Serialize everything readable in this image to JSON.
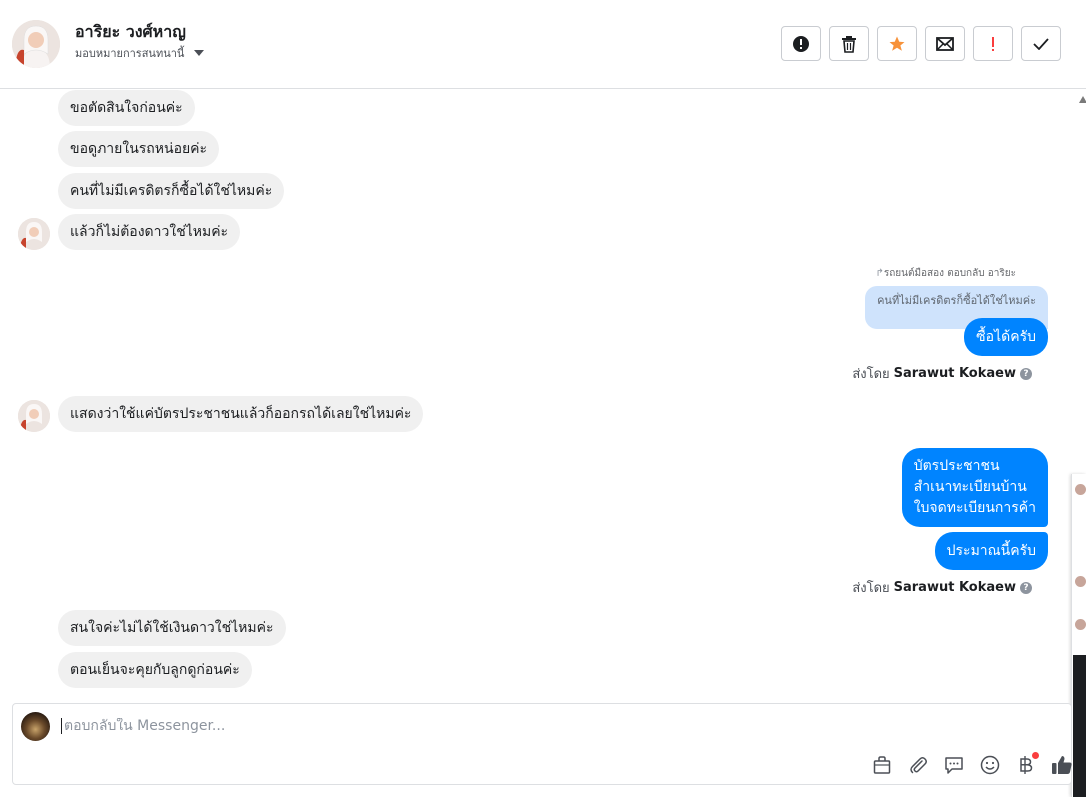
{
  "header": {
    "contact_name": "อาริยะ วงศ์หาญ",
    "assign_label": "มอบหมายการสนทนานี้",
    "actions": [
      {
        "name": "spam-button",
        "icon": "alert-circle-icon"
      },
      {
        "name": "delete-button",
        "icon": "trash-icon"
      },
      {
        "name": "star-button",
        "icon": "star-icon",
        "color": "#f7923a"
      },
      {
        "name": "mark-unread-button",
        "icon": "envelope-icon"
      },
      {
        "name": "follow-up-button",
        "icon": "exclamation-icon",
        "color": "#fa3e3e"
      },
      {
        "name": "mark-done-button",
        "icon": "check-icon"
      }
    ]
  },
  "messages": {
    "m1": "ขอตัดสินใจก่อนค่ะ",
    "m2": "ขอดูภายในรถหน่อยค่ะ",
    "m3": "คนที่ไม่มีเครดิตรก็ซื้อได้ใช่ไหมค่ะ",
    "m4": "แล้วก็ไม่ต้องดาวใช่ไหมค่ะ",
    "reply_note": "รถยนต์มือสอง ตอบกลับ อาริยะ",
    "reply_quote": "คนที่ไม่มีเครดิตรก็ซื้อได้ใช่ไหมค่ะ",
    "out1": "ซื้อได้ครับ",
    "sent_by_label": "ส่งโดย",
    "sent_by_name": "Sarawut Kokaew",
    "m5": "แสดงว่าใช้แค่บัตรประชาชนแล้วก็ออกรถได้เลยใช่ไหมค่ะ",
    "out2_line1": "บัตรประชาชน",
    "out2_line2": "สำเนาทะเบียนบ้าน",
    "out2_line3": "ใบจดทะเบียนการค้า",
    "out3": "ประมาณนี้ครับ",
    "m6": "สนใจค่ะไม่ได้ใช้เงินดาวใช่ไหมค่ะ",
    "m7": "ตอนเย็นจะคุยกับลูกดูก่อนค่ะ"
  },
  "composer": {
    "placeholder": "ตอบกลับใน Messenger...",
    "tools": [
      "bag-icon",
      "paperclip-icon",
      "saved-reply-icon",
      "emoji-icon",
      "baht-icon",
      "thumbs-up-icon"
    ]
  },
  "colors": {
    "outgoing": "#0084ff",
    "incoming": "#f0f0f0",
    "reply_quote": "#cfe3fc"
  }
}
